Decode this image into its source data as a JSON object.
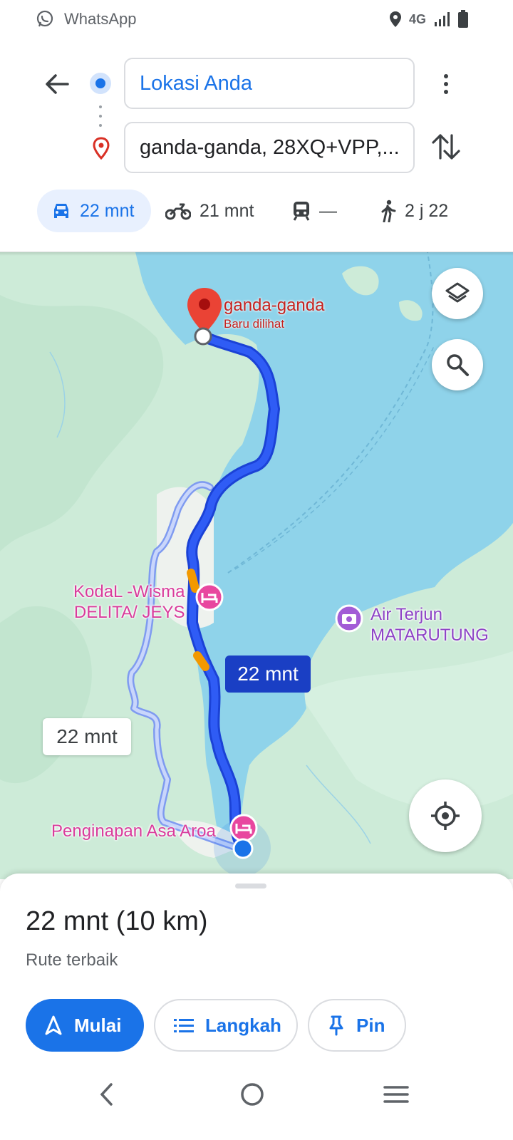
{
  "status_bar": {
    "app_name": "WhatsApp",
    "network": "4G"
  },
  "directions": {
    "origin": "Lokasi Anda",
    "destination": "ganda-ganda, 28XQ+VPP,..."
  },
  "modes": [
    {
      "name": "car",
      "icon": "car-icon",
      "time": "22 mnt",
      "selected": true
    },
    {
      "name": "motorcycle",
      "icon": "motorcycle-icon",
      "time": "21 mnt"
    },
    {
      "name": "transit",
      "icon": "train-icon",
      "time": "—"
    },
    {
      "name": "walk",
      "icon": "walk-icon",
      "time": "2 j 22"
    }
  ],
  "map": {
    "destination_label": "ganda-ganda",
    "destination_sub": "Baru dilihat",
    "poi_hotel_1": "KodaL -Wisma\nDELITA/ JEYS",
    "poi_waterfall": "Air Terjun\nMATARUTUNG",
    "poi_hotel_2": "Penginapan Asa Aroa",
    "route_time_primary": "22 mnt",
    "route_time_alt": "22 mnt"
  },
  "sheet": {
    "summary": "22 mnt (10 km)",
    "subtitle": "Rute terbaik",
    "start_label": "Mulai",
    "steps_label": "Langkah",
    "pin_label": "Pin"
  },
  "colors": {
    "accent": "#1a73e8",
    "route": "#1a3fc4",
    "water": "#8fd3ea",
    "land": "#cdebd8",
    "poi": "#d93b9b"
  }
}
